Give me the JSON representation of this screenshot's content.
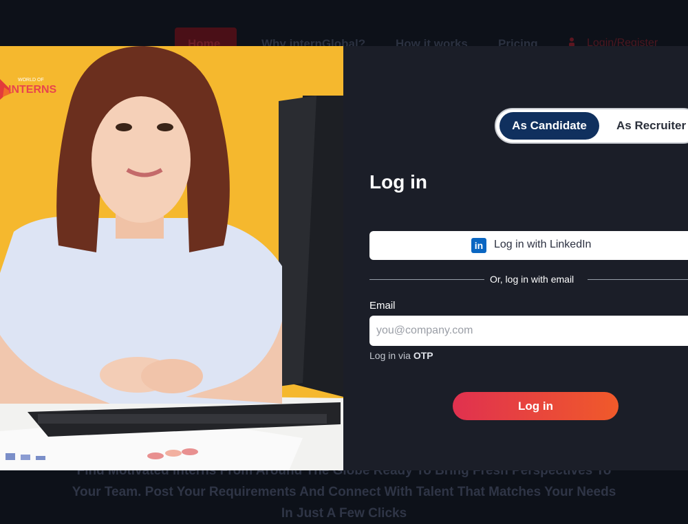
{
  "background_nav": {
    "home": "Home",
    "why": "Why internGlobal?",
    "how": "How it works",
    "pricing": "Pricing",
    "login_register": "Login/Register"
  },
  "background_footer": {
    "line1": "Find Motivated Interns From Around The Globe Ready To Bring Fresh Perspectives To",
    "line2": "Your Team. Post Your Requirements And Connect With Talent That Matches Your Needs",
    "line3": "In Just A Few Clicks"
  },
  "logo": {
    "top": "WORLD OF",
    "main": "INTERNS"
  },
  "toggle": {
    "candidate": "As Candidate",
    "recruiter": "As Recruiter",
    "selected": "As Candidate"
  },
  "form": {
    "title": "Log in",
    "linkedin_label": "Log in with LinkedIn",
    "linkedin_icon": "in",
    "divider": "Or, log in with email",
    "email_label": "Email",
    "email_placeholder": "you@company.com",
    "email_value": "",
    "otp_prefix": "Log in via",
    "otp_link": "OTP",
    "submit": "Log in"
  },
  "colors": {
    "accent_navy": "#10305e",
    "submit_gradient_start": "#e0314f",
    "submit_gradient_end": "#f05a2a",
    "linkedin_blue": "#0a66c2",
    "photo_background": "#f5b82e"
  }
}
